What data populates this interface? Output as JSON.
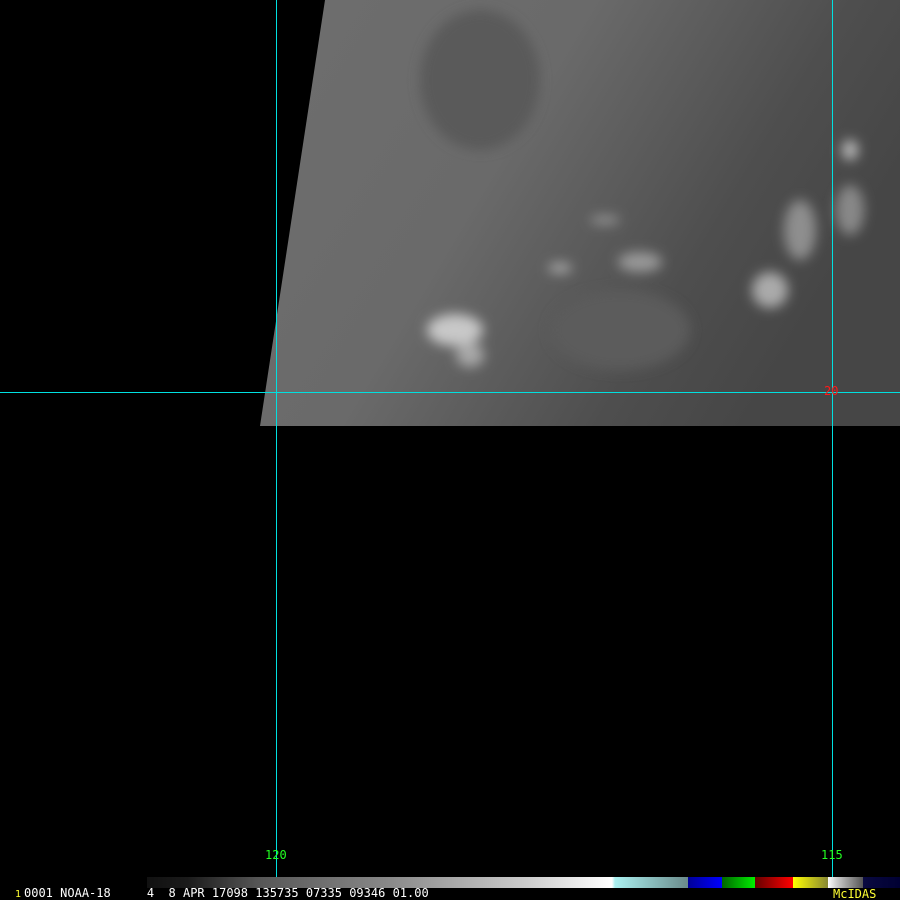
{
  "image": {
    "satellite": "NOAA-18",
    "frame_number": "1",
    "frame_id": "0001",
    "band": "4",
    "date": "8 APR 17098",
    "time": "135735",
    "line": "07335",
    "element": "09346",
    "resolution": "01.00",
    "software": "McIDAS"
  },
  "grid_labels": {
    "lon_120": "120",
    "lon_115": "115",
    "lat_20": "20"
  },
  "colors": {
    "gridline": "#00e0e0",
    "lon_label": "#22ff22",
    "lat_label": "#ff1a1a",
    "logo": "#ffff33"
  }
}
